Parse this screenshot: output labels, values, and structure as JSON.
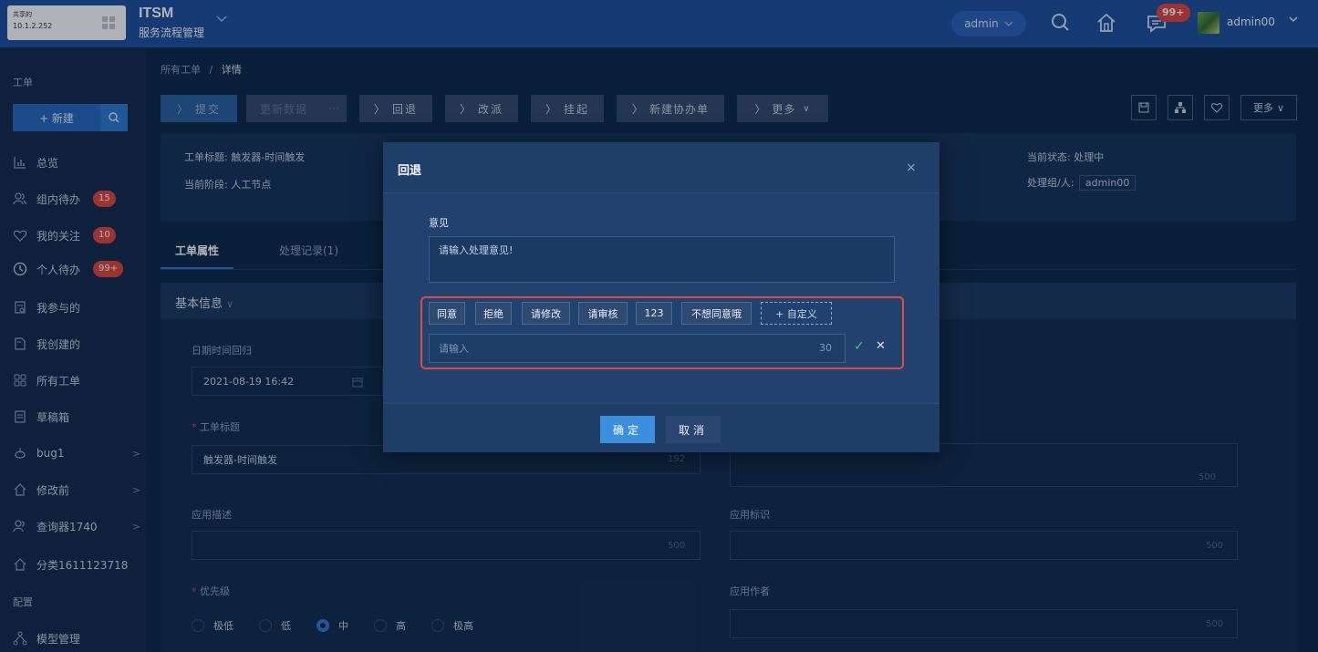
{
  "topbar": {
    "logo_line1": "共享的",
    "logo_line2": "10.1.2.252",
    "app_title": "ITSM",
    "app_subtitle": "服务流程管理",
    "user_select": "admin",
    "notification_badge": "99+",
    "user_name": "admin00"
  },
  "sidebar": {
    "heading_work": "工单",
    "new_button": "+ 新建",
    "heading_config": "配置",
    "items": [
      {
        "label": "总览",
        "icon": "chart-icon"
      },
      {
        "label": "组内待办",
        "badge": "15",
        "icon": "group-icon"
      },
      {
        "label": "我的关注",
        "badge": "10",
        "icon": "heart-icon"
      },
      {
        "label": "个人待办",
        "badge": "99+",
        "icon": "clock-icon"
      },
      {
        "label": "我参与的",
        "icon": "doc-icon"
      },
      {
        "label": "我创建的",
        "icon": "file-icon"
      },
      {
        "label": "所有工单",
        "icon": "grid-icon"
      },
      {
        "label": "草稿箱",
        "icon": "draft-icon"
      },
      {
        "label": "bug1",
        "icon": "bug-icon"
      },
      {
        "label": "修改前",
        "icon": "home-icon"
      },
      {
        "label": "查询器1740",
        "icon": "group-icon"
      },
      {
        "label": "分类1611123718",
        "icon": "home-icon"
      },
      {
        "label": "模型管理",
        "icon": "model-icon"
      }
    ]
  },
  "breadcrumb": {
    "parent": "所有工单",
    "separator": "/",
    "current": "详情"
  },
  "toolbar": {
    "submit": "提交",
    "update_data": "更新数据",
    "ellipsis": "···",
    "rollback": "回退",
    "reassign": "改派",
    "suspend": "挂起",
    "new_assist": "新建协办单",
    "more": "更多",
    "more_right": "更多"
  },
  "info": {
    "title_label": "工单标题:",
    "title_value": "触发器-时间触发",
    "stage_label": "当前阶段:",
    "stage_value": "人工节点",
    "status_label": "当前状态:",
    "status_value": "处理中",
    "handler_label": "处理组/人:",
    "handler_value": "admin00"
  },
  "tabs": {
    "attributes": "工单属性",
    "records": "处理记录(1)"
  },
  "section": {
    "title": "基本信息",
    "date_label": "日期时间回归",
    "date_value": "2021-08-19 16:42",
    "ticket_title_label": "工单标题",
    "ticket_title_value": "触发器-时间触发",
    "ticket_title_count": "192",
    "right_count": "500",
    "app_desc_label": "应用描述",
    "app_desc_count": "500",
    "app_id_label": "应用标识",
    "app_id_count": "500",
    "priority_label": "优先级",
    "priority_options": [
      "极低",
      "低",
      "中",
      "高",
      "极高"
    ],
    "priority_selected": "中",
    "app_author_label": "应用作者",
    "app_author_count": "500"
  },
  "dialog": {
    "title": "回退",
    "close": "×",
    "opinion_label": "意见",
    "opinion_placeholder": "请输入处理意见!",
    "tags": [
      "同意",
      "拒绝",
      "请修改",
      "请审核",
      "123",
      "不想同意哦"
    ],
    "custom_tag": "+ 自定义",
    "input_placeholder": "请输入",
    "input_count": "30",
    "confirm": "确定",
    "cancel": "取消"
  }
}
